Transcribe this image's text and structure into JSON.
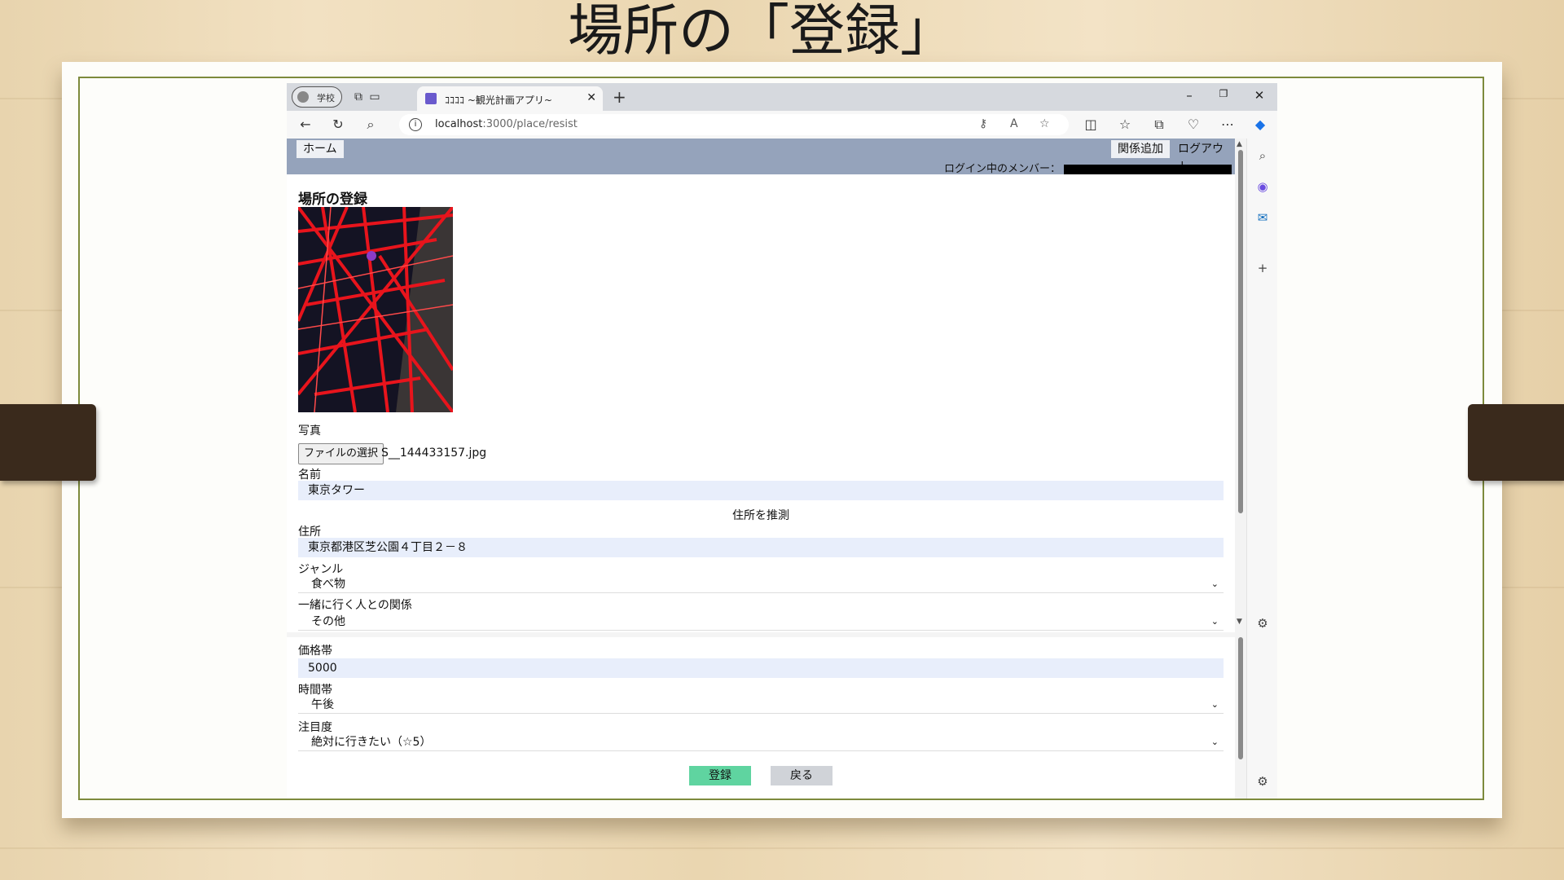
{
  "slide": {
    "title": "場所の「登録」"
  },
  "browser": {
    "profile_label": "学校",
    "tab_title": "ｺｺｺｺ ~観光計画アプリ~",
    "url_host": "localhost",
    "url_rest": ":3000/place/resist",
    "window_controls": [
      "–",
      "❐",
      "✕"
    ]
  },
  "header": {
    "home": "ホーム",
    "add_relation": "関係追加",
    "logout": "ログアウト",
    "login_member": "ログイン中のメンバー："
  },
  "form": {
    "title": "場所の登録",
    "photo_label": "写真",
    "file_button": "ファイルの選択",
    "file_name": "S__144433157.jpg",
    "name_label": "名前",
    "name_value": "東京タワー",
    "guess_address": "住所を推測",
    "address_label": "住所",
    "address_value": "東京都港区芝公園４丁目２－８",
    "genre_label": "ジャンル",
    "genre_value": "食べ物",
    "relation_label": "一緒に行く人との関係",
    "relation_value": "その他",
    "price_label": "価格帯",
    "price_value": "5000",
    "time_label": "時間帯",
    "time_value": "午後",
    "attention_label": "注目度",
    "attention_value": "絶対に行きたい（☆5）",
    "submit": "登録",
    "back": "戻る"
  },
  "colors": {
    "header_bg": "#95a3bb",
    "submit_bg": "#5fd4a0",
    "field_bg": "#e8eefb"
  }
}
